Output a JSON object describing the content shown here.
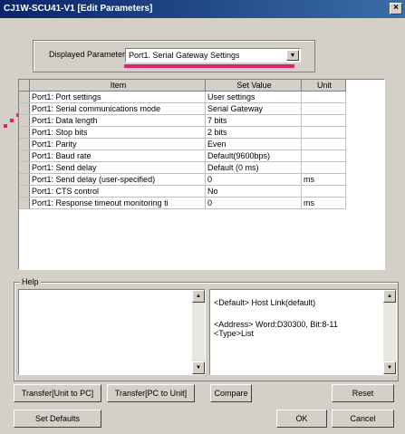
{
  "window": {
    "title": "CJ1W-SCU41-V1 [Edit Parameters]",
    "close_label": "×"
  },
  "displayed_parameter": {
    "label": "Displayed Parameter",
    "value": "Port1. Serial Gateway Settings"
  },
  "table": {
    "columns": [
      "Item",
      "Set Value",
      "Unit"
    ],
    "rows": [
      {
        "item": "Port1: Port settings",
        "value": "User settings",
        "unit": ""
      },
      {
        "item": "Port1: Serial communications mode",
        "value": "Serial Gateway",
        "unit": ""
      },
      {
        "item": "Port1: Data length",
        "value": "7 bits",
        "unit": ""
      },
      {
        "item": "Port1: Stop bits",
        "value": "2 bits",
        "unit": ""
      },
      {
        "item": "Port1: Parity",
        "value": "Even",
        "unit": ""
      },
      {
        "item": "Port1: Baud rate",
        "value": "Default(9600bps)",
        "unit": ""
      },
      {
        "item": "Port1: Send delay",
        "value": "Default (0 ms)",
        "unit": ""
      },
      {
        "item": "Port1: Send delay (user-specified)",
        "value": "0",
        "unit": "ms"
      },
      {
        "item": "Port1: CTS control",
        "value": "No",
        "unit": ""
      },
      {
        "item": "Port1: Response timeout monitoring ti",
        "value": "0",
        "unit": "ms"
      }
    ]
  },
  "help": {
    "label": "Help",
    "left_text": "",
    "right_line1": "<Default> Host Link(default)",
    "right_line2": "<Address> Word:D30300, Bit:8-11",
    "right_line3": "<Type>List"
  },
  "buttons": {
    "transfer_to_pc": "Transfer[Unit to PC]",
    "transfer_to_unit": "Transfer[PC to Unit]",
    "compare": "Compare",
    "reset": "Reset",
    "set_defaults": "Set Defaults",
    "ok": "OK",
    "cancel": "Cancel"
  },
  "colors": {
    "annotation": "#e0246b",
    "titlebar": "#0a246a"
  }
}
